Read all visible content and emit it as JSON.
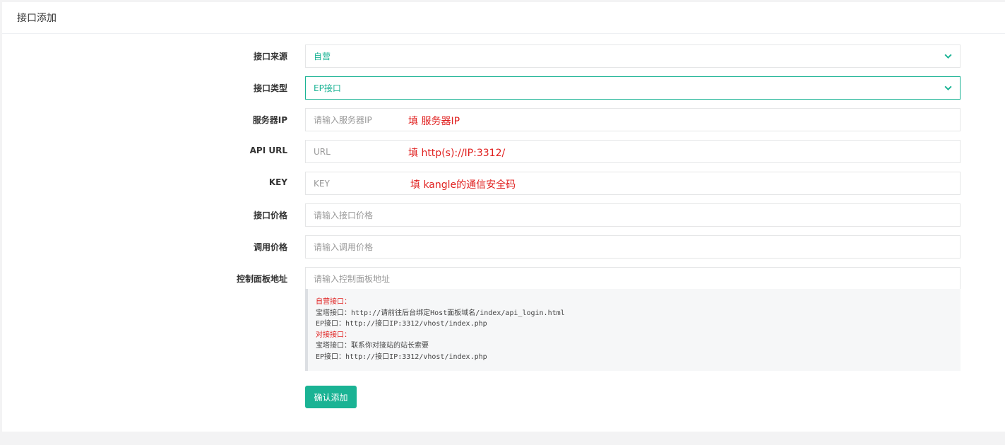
{
  "panel": {
    "title": "接口添加"
  },
  "form": {
    "source": {
      "label": "接口来源",
      "value": "自营"
    },
    "type": {
      "label": "接口类型",
      "value": "EP接口"
    },
    "server_ip": {
      "label": "服务器IP",
      "placeholder": "请输入服务器IP",
      "annotation": "填 服务器IP"
    },
    "api_url": {
      "label": "API URL",
      "placeholder": "URL",
      "annotation": "填 http(s)://IP:3312/"
    },
    "key": {
      "label": "KEY",
      "placeholder": "KEY",
      "annotation": "填 kangle的通信安全码"
    },
    "api_price": {
      "label": "接口价格",
      "placeholder": "请输入接口价格"
    },
    "call_price": {
      "label": "调用价格",
      "placeholder": "请输入调用价格"
    },
    "panel_url": {
      "label": "控制面板地址",
      "placeholder": "请输入控制面板地址"
    }
  },
  "help": {
    "lines": [
      "自营接口：",
      "宝塔接口：http://请前往后台绑定Host面板域名/index/api_login.html",
      "EP接口：http://接口IP:3312/vhost/index.php",
      "对接接口：",
      "宝塔接口：联系你对接站的站长索要",
      "EP接口：http://接口IP:3312/vhost/index.php"
    ]
  },
  "submit_label": "确认添加",
  "colors": {
    "accent": "#1ab394",
    "annotation": "#e0201f"
  }
}
